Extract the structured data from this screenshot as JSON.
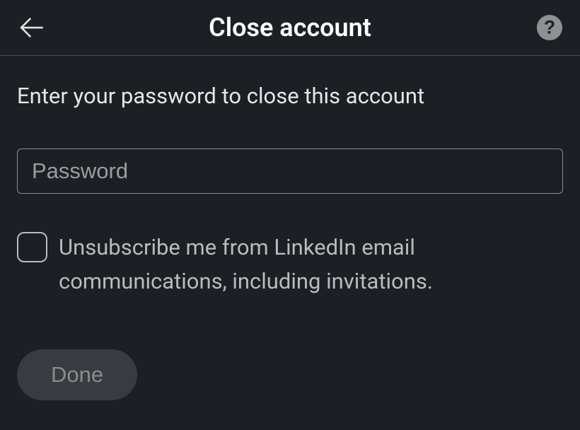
{
  "header": {
    "title": "Close account"
  },
  "content": {
    "instruction": "Enter your password to close this account",
    "password_placeholder": "Password",
    "checkbox_label": "Unsubscribe me from LinkedIn email communications, including invitations.",
    "done_label": "Done"
  }
}
